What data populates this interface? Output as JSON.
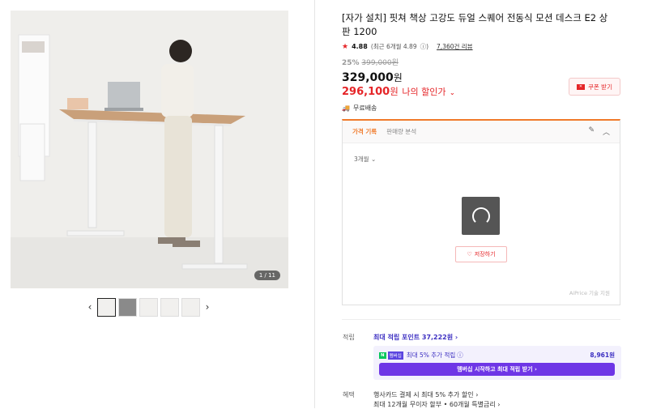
{
  "product": {
    "title": "[자가 설치] 핏쳐 책상 고강도 듀얼 스퀘어 전동식 모션 데스크 E2 상판 1200",
    "rating": "4.88",
    "rating_detail": "(최근 6개월 4.89",
    "review_count": "7,360건 리뷰",
    "discount_pct": "25%",
    "original_price": "399,000원",
    "price_value": "329,000",
    "price_unit": "원",
    "my_price_value": "296,100",
    "my_price_unit": "원",
    "my_price_label": "나의 할인가",
    "coupon_label": "쿠폰 받기",
    "shipping": "무료배송"
  },
  "gallery": {
    "counter": "1 / 11",
    "thumb_count": 6
  },
  "price_panel": {
    "tab_active": "가격 기록",
    "tab_other": "판매량 분석",
    "period": "3개월",
    "save_label": "저장하기",
    "credit": "AiPrice 기술 지원"
  },
  "points": {
    "label": "적립",
    "max": "최대 적립 포인트 37,222원",
    "npay_badge": "N",
    "npay_badge2": "멤버십",
    "npay_text": "최대 5% 추가 적립",
    "npay_amount": "8,961원",
    "membership_button": "멤버십 시작하고 최대 적립 받기"
  },
  "benefits": {
    "label": "혜택",
    "line1": "행사카드 결제 시 최대 5% 추가 할인",
    "line2": "최대 12개월 무이자 할부 • 60개월 특별금리"
  },
  "colors": {
    "accent_red": "#e52528",
    "accent_orange": "#f07a2a",
    "accent_purple": "#6e36e6"
  }
}
